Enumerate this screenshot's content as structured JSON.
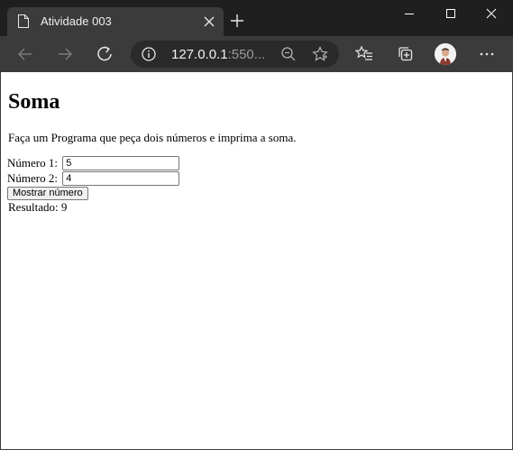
{
  "browser": {
    "tab_title": "Atividade 003",
    "url_host": "127.0.0.1",
    "url_rest": ":550..."
  },
  "page": {
    "heading": "Soma",
    "description": "Faça um Programa que peça dois números e imprima a soma.",
    "field1_label": "Número 1:",
    "field1_value": "5",
    "field2_label": "Número 2:",
    "field2_value": "4",
    "button_label": "Mostrar número",
    "result_label": "Resultado:",
    "result_value": "9"
  }
}
